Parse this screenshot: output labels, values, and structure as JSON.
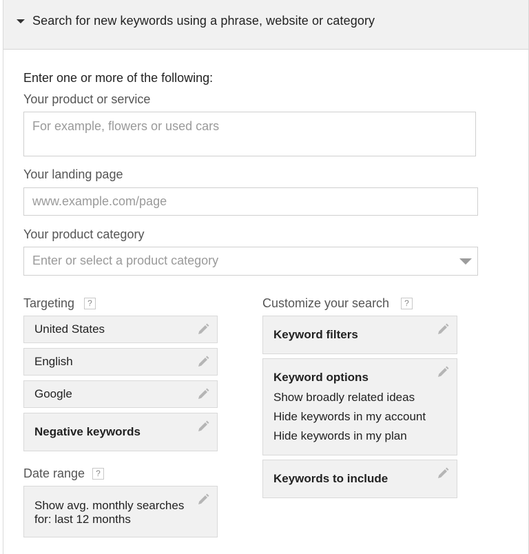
{
  "header": {
    "title": "Search for new keywords using a phrase, website or category"
  },
  "form": {
    "intro": "Enter one or more of the following:",
    "product": {
      "label": "Your product or service",
      "placeholder": "For example, flowers or used cars"
    },
    "landing": {
      "label": "Your landing page",
      "placeholder": "www.example.com/page"
    },
    "category": {
      "label": "Your product category",
      "placeholder": "Enter or select a product category"
    }
  },
  "targeting": {
    "label": "Targeting",
    "help": "?",
    "items": [
      "United States",
      "English",
      "Google",
      "Negative keywords"
    ]
  },
  "date_range": {
    "label": "Date range",
    "help": "?",
    "line1": "Show avg. monthly searches",
    "line2": "for: last 12 months"
  },
  "customize": {
    "label": "Customize your search",
    "help": "?",
    "filters": "Keyword filters",
    "options": {
      "title": "Keyword options",
      "lines": [
        "Show broadly related ideas",
        "Hide keywords in my account",
        "Hide keywords in my plan"
      ]
    },
    "include": "Keywords to include"
  },
  "colors": {
    "box_bg": "#f1f1f1",
    "pencil": "#b5b5b5",
    "placeholder": "#9a9a9a"
  }
}
